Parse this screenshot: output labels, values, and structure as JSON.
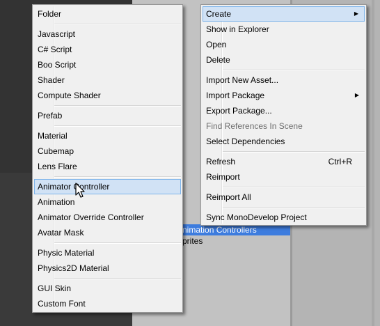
{
  "project_panel": {
    "rows": [
      {
        "label": "Animation Controllers",
        "selected": true
      },
      {
        "label": "Sprites",
        "selected": false
      }
    ]
  },
  "context_menu": {
    "items": [
      {
        "label": "Create",
        "has_submenu": true,
        "highlighted": true
      },
      {
        "label": "Show in Explorer"
      },
      {
        "label": "Open"
      },
      {
        "label": "Delete"
      },
      {
        "label": "Import New Asset..."
      },
      {
        "label": "Import Package",
        "has_submenu": true
      },
      {
        "label": "Export Package..."
      },
      {
        "label": "Find References In Scene",
        "disabled": true
      },
      {
        "label": "Select Dependencies"
      },
      {
        "label": "Refresh",
        "shortcut": "Ctrl+R"
      },
      {
        "label": "Reimport"
      },
      {
        "label": "Reimport All"
      },
      {
        "label": "Sync MonoDevelop Project"
      }
    ]
  },
  "create_submenu": {
    "items": [
      {
        "label": "Folder"
      },
      {
        "label": "Javascript"
      },
      {
        "label": "C# Script"
      },
      {
        "label": "Boo Script"
      },
      {
        "label": "Shader"
      },
      {
        "label": "Compute Shader"
      },
      {
        "label": "Prefab"
      },
      {
        "label": "Material"
      },
      {
        "label": "Cubemap"
      },
      {
        "label": "Lens Flare"
      },
      {
        "label": "Animator Controller",
        "highlighted": true
      },
      {
        "label": "Animation"
      },
      {
        "label": "Animator Override Controller"
      },
      {
        "label": "Avatar Mask"
      },
      {
        "label": "Physic Material"
      },
      {
        "label": "Physics2D Material"
      },
      {
        "label": "GUI Skin"
      },
      {
        "label": "Custom Font"
      }
    ]
  },
  "icons": {
    "submenu_arrow": "triangle-right-icon",
    "cursor": "mouse-pointer-icon"
  }
}
